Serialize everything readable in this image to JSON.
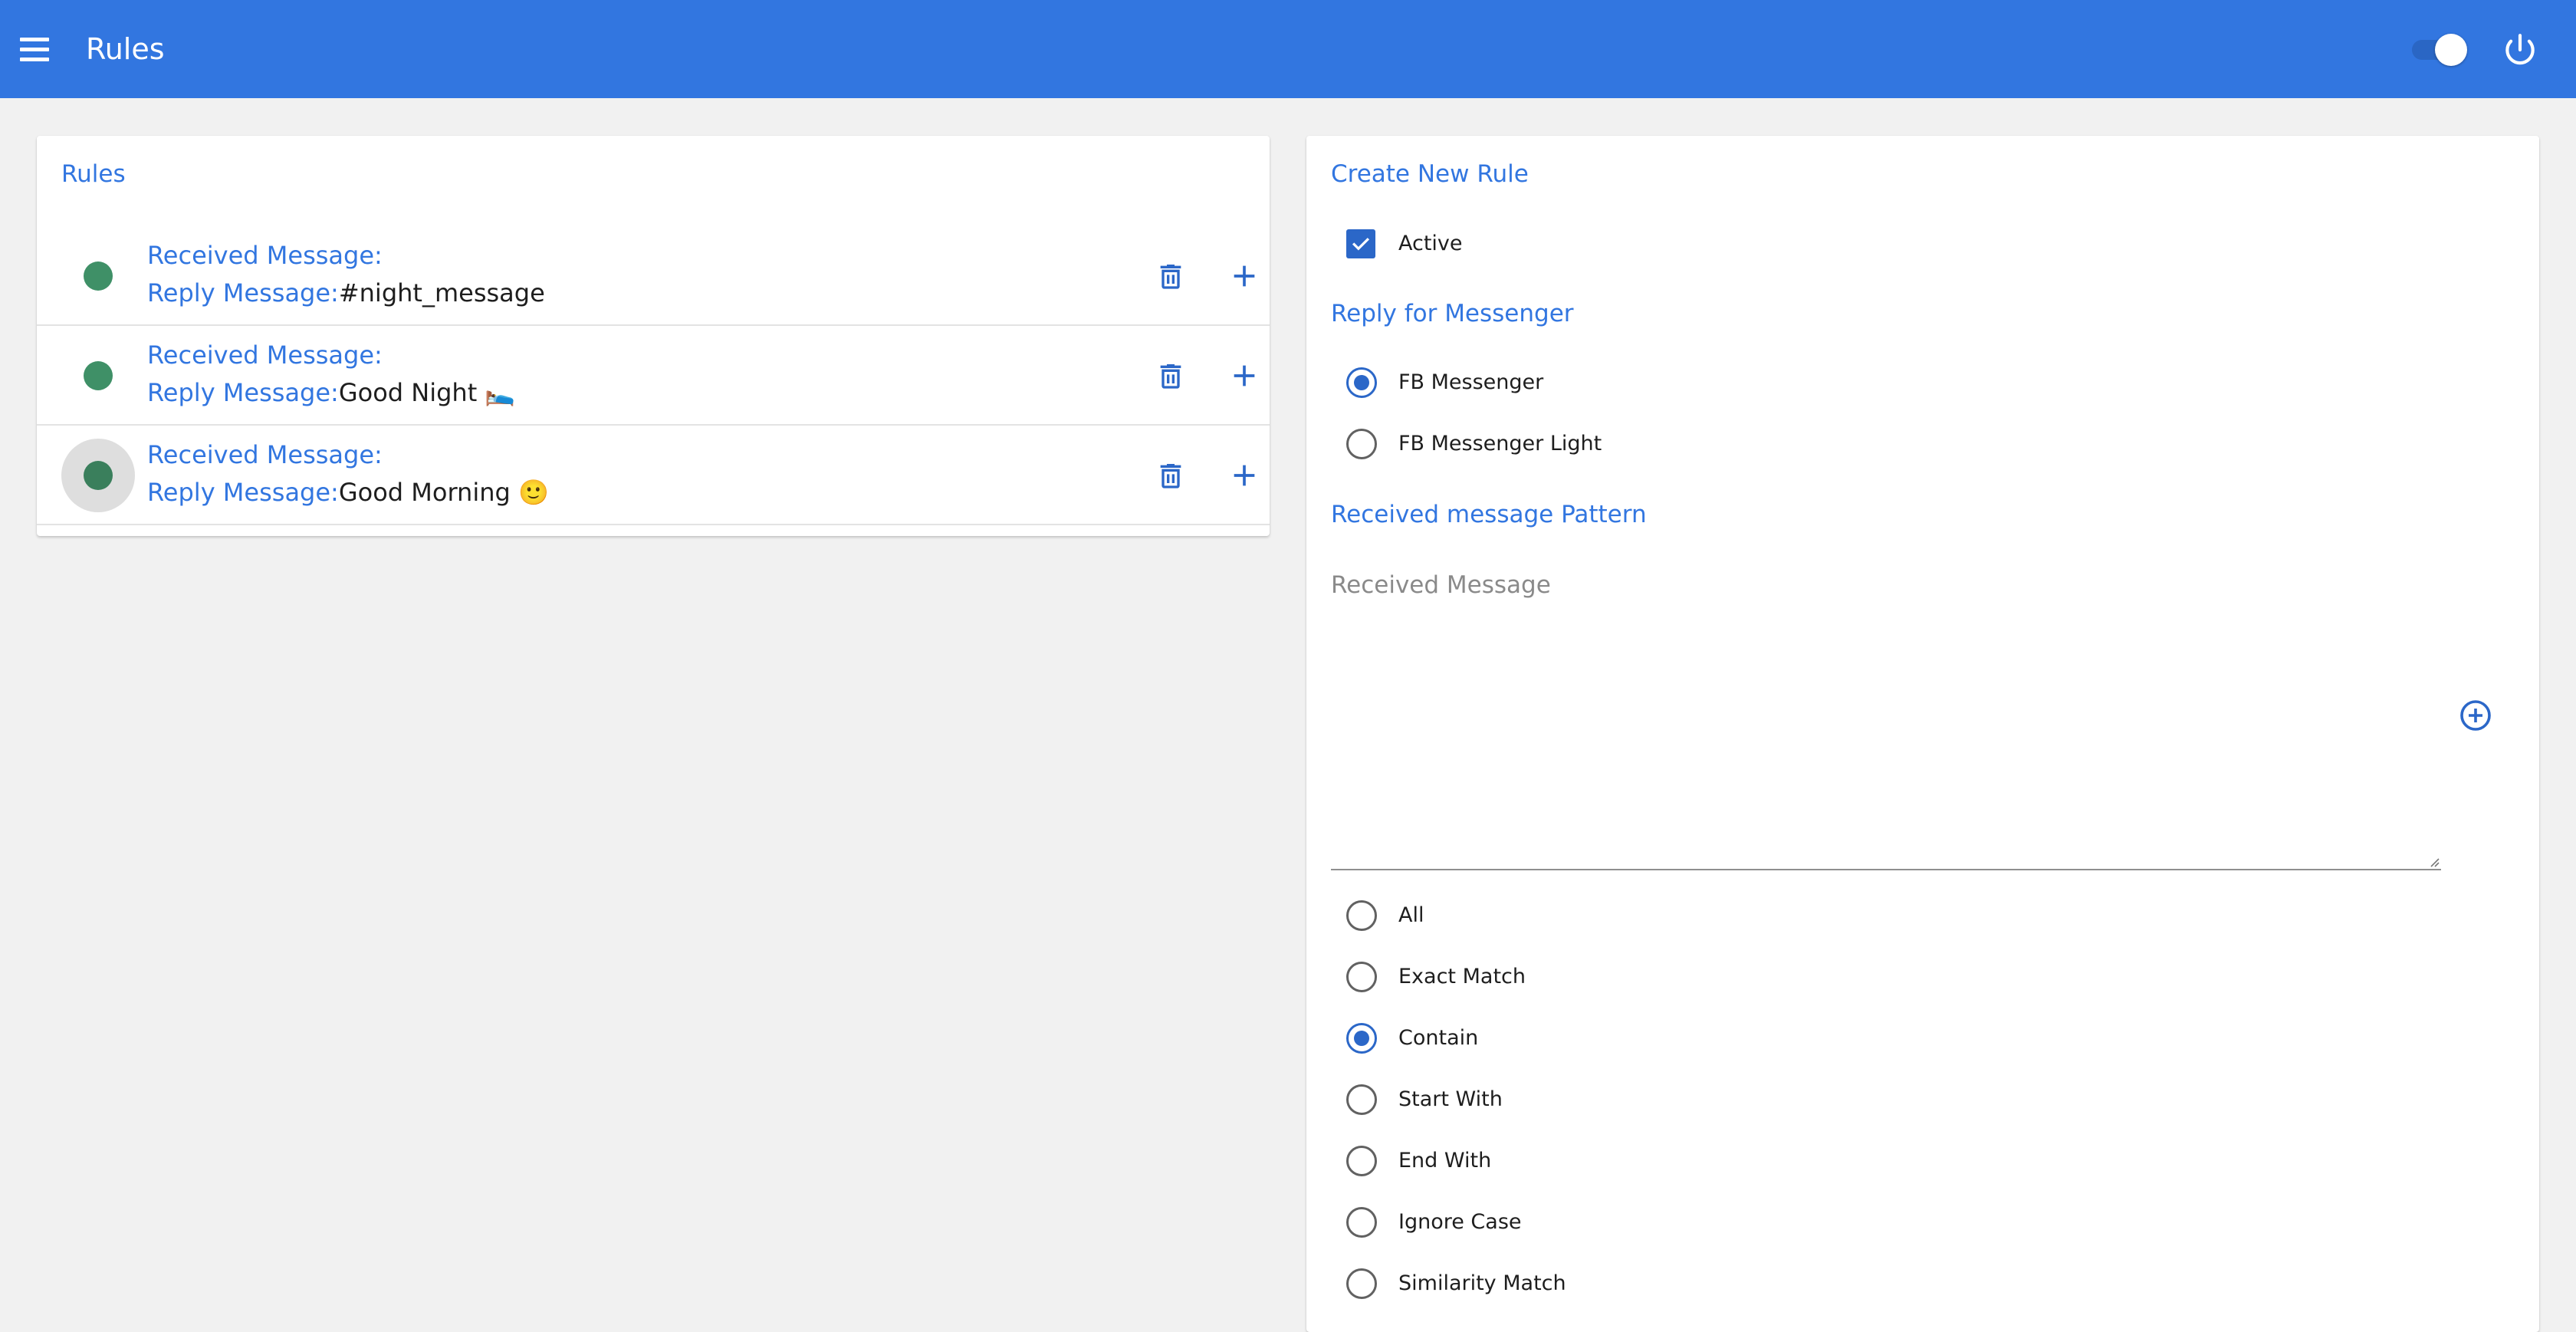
{
  "appbar": {
    "title": "Rules",
    "bg_color": "#3276e0",
    "menu_icon": "menu-icon",
    "toggle_on": true,
    "power_icon": "power-icon"
  },
  "rules_card": {
    "heading": "Rules",
    "rules": [
      {
        "active": true,
        "received_label": "Received Message:",
        "received_value": "",
        "reply_label": "Reply Message:",
        "reply_value": "#night_message"
      },
      {
        "active": true,
        "received_label": "Received Message:",
        "received_value": "",
        "reply_label": "Reply Message:",
        "reply_value": "Good Night 🛌"
      },
      {
        "active": true,
        "received_label": "Received Message:",
        "received_value": "",
        "reply_label": "Reply Message:",
        "reply_value": "Good Morning 🙂"
      }
    ],
    "delete_icon": "trash-icon",
    "add_icon": "plus-icon",
    "status_color": "#3f9067"
  },
  "create_card": {
    "heading": "Create New Rule",
    "active_label": "Active",
    "active_checked": true,
    "messenger_heading": "Reply for Messenger",
    "messenger_options": [
      {
        "label": "FB Messenger",
        "checked": true
      },
      {
        "label": "FB Messenger Light",
        "checked": false
      }
    ],
    "pattern_heading": "Received message Pattern",
    "pattern_placeholder": "Received Message",
    "pattern_value": "",
    "add_pattern_icon": "plus-circle-icon",
    "match_options": [
      {
        "label": "All",
        "checked": false
      },
      {
        "label": "Exact Match",
        "checked": false
      },
      {
        "label": "Contain",
        "checked": true
      },
      {
        "label": "Start With",
        "checked": false
      },
      {
        "label": "End With",
        "checked": false
      },
      {
        "label": "Ignore Case",
        "checked": false
      },
      {
        "label": "Similarity Match",
        "checked": false
      }
    ],
    "accent_color": "#2b67c8"
  }
}
